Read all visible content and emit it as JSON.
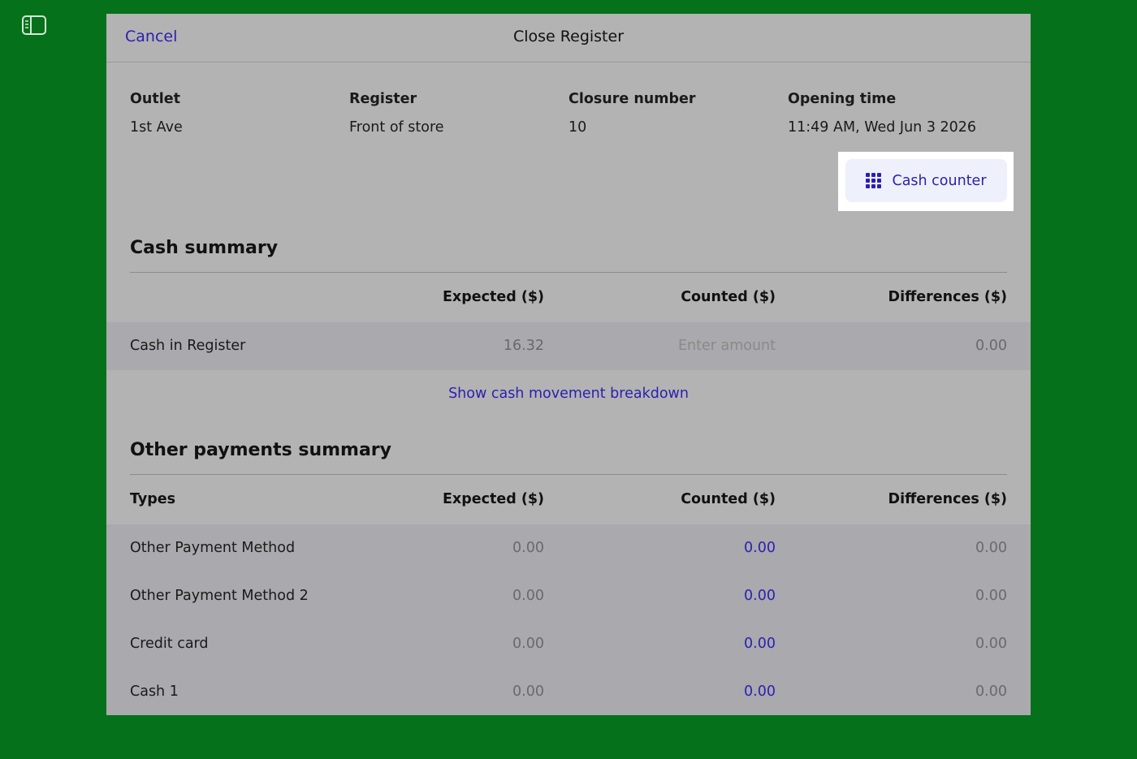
{
  "header": {
    "cancel_label": "Cancel",
    "title": "Close Register"
  },
  "info": {
    "outlet": {
      "label": "Outlet",
      "value": "1st Ave"
    },
    "register": {
      "label": "Register",
      "value": "Front of store"
    },
    "closure": {
      "label": "Closure number",
      "value": "10"
    },
    "opening": {
      "label": "Opening time",
      "value": "11:49 AM, Wed Jun 3 2026"
    }
  },
  "cash_counter_label": "Cash counter",
  "cash_summary": {
    "title": "Cash summary",
    "columns": {
      "expected": "Expected ($)",
      "counted": "Counted ($)",
      "differences": "Differences ($)"
    },
    "row": {
      "label": "Cash in Register",
      "expected": "16.32",
      "counted_placeholder": "Enter amount",
      "difference": "0.00"
    },
    "breakdown_link": "Show cash movement breakdown"
  },
  "other_payments": {
    "title": "Other payments summary",
    "columns": {
      "types": "Types",
      "expected": "Expected ($)",
      "counted": "Counted ($)",
      "differences": "Differences ($)"
    },
    "rows": [
      {
        "type": "Other Payment Method",
        "expected": "0.00",
        "counted": "0.00",
        "difference": "0.00"
      },
      {
        "type": "Other Payment Method 2",
        "expected": "0.00",
        "counted": "0.00",
        "difference": "0.00"
      },
      {
        "type": "Credit card",
        "expected": "0.00",
        "counted": "0.00",
        "difference": "0.00"
      },
      {
        "type": "Cash 1",
        "expected": "0.00",
        "counted": "0.00",
        "difference": "0.00"
      }
    ]
  },
  "colors": {
    "background": "#05711a",
    "accent": "#2b1fb0",
    "modal": "#b3b3b3"
  }
}
